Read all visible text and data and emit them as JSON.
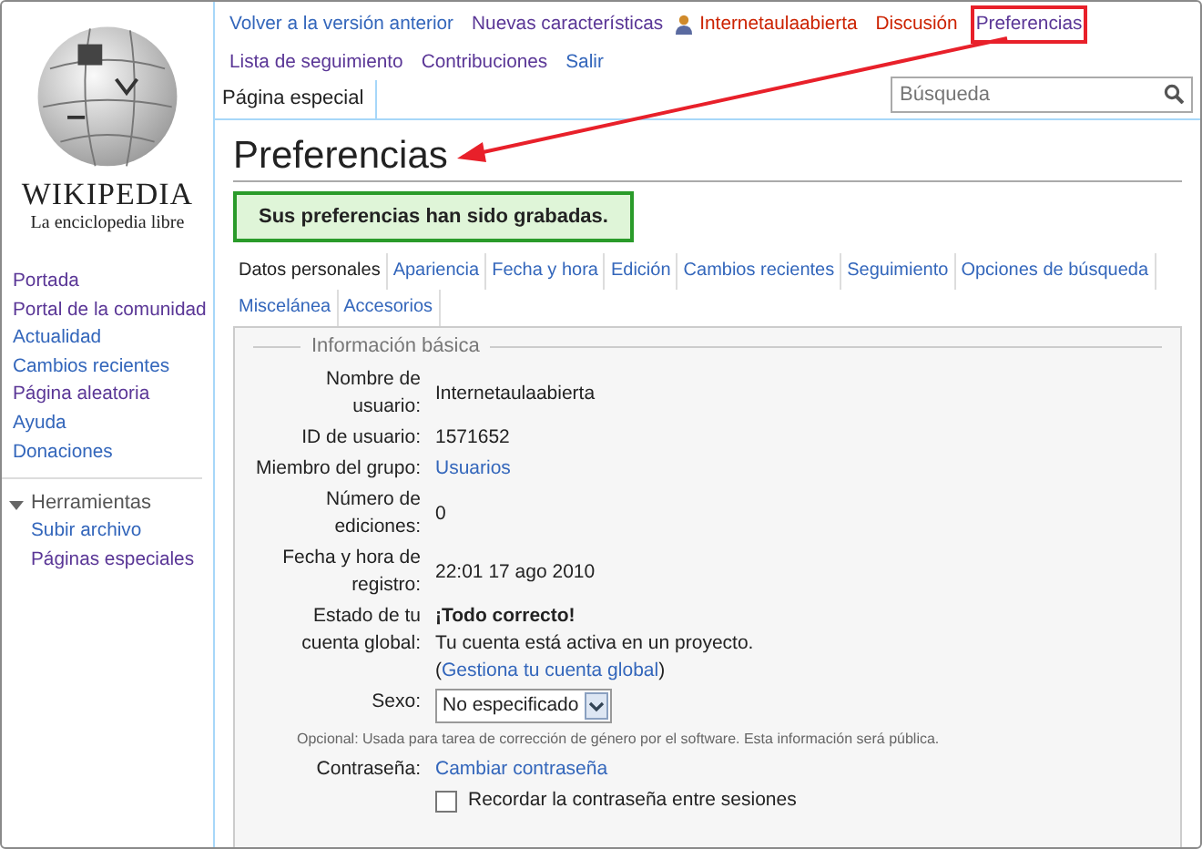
{
  "logo": {
    "wordmark": "WIKIPEDIA",
    "tagline": "La enciclopedia libre"
  },
  "top_links": [
    {
      "label": "Volver a la versión anterior",
      "color": "#3366bb",
      "kind": "link",
      "highlighted": false
    },
    {
      "label": "Nuevas características",
      "color": "#5a3696",
      "kind": "link",
      "highlighted": false
    },
    {
      "label": "Internetaulaabierta",
      "color": "#cc2200",
      "kind": "user",
      "highlighted": false
    },
    {
      "label": "Discusión",
      "color": "#cc2200",
      "kind": "link",
      "highlighted": false
    },
    {
      "label": "Preferencias",
      "color": "#5a3696",
      "kind": "link",
      "highlighted": true
    },
    {
      "label": "Lista de seguimiento",
      "color": "#5a3696",
      "kind": "link",
      "highlighted": false
    },
    {
      "label": "Contribuciones",
      "color": "#5a3696",
      "kind": "link",
      "highlighted": false
    },
    {
      "label": "Salir",
      "color": "#3366bb",
      "kind": "link",
      "highlighted": false
    }
  ],
  "page_tab": {
    "label": "Página especial",
    "selected": true
  },
  "search": {
    "placeholder": "Búsqueda"
  },
  "sidebar": {
    "items": [
      {
        "label": "Portada",
        "color": "#5a3696"
      },
      {
        "label": "Portal de la comunidad",
        "color": "#5a3696"
      },
      {
        "label": "Actualidad",
        "color": "#3366bb"
      },
      {
        "label": "Cambios recientes",
        "color": "#3366bb"
      },
      {
        "label": "Página aleatoria",
        "color": "#5a3696"
      },
      {
        "label": "Ayuda",
        "color": "#3366bb"
      },
      {
        "label": "Donaciones",
        "color": "#3366bb"
      }
    ],
    "tools": {
      "title": "Herramientas",
      "expanded": true,
      "items": [
        {
          "label": "Subir archivo",
          "color": "#3366bb"
        },
        {
          "label": "Páginas especiales",
          "color": "#5a3696"
        }
      ]
    }
  },
  "title": "Preferencias",
  "success_message": "Sus preferencias han sido grabadas.",
  "pref_tabs": [
    {
      "label": "Datos personales",
      "selected": true
    },
    {
      "label": "Apariencia",
      "selected": false
    },
    {
      "label": "Fecha y hora",
      "selected": false
    },
    {
      "label": "Edición",
      "selected": false
    },
    {
      "label": "Cambios recientes",
      "selected": false
    },
    {
      "label": "Seguimiento",
      "selected": false
    },
    {
      "label": "Opciones de búsqueda",
      "selected": false
    },
    {
      "label": "Miscelánea",
      "selected": false
    },
    {
      "label": "Accesorios",
      "selected": false
    }
  ],
  "section": {
    "legend": "Información básica",
    "rows": [
      {
        "kind": "text",
        "label": "Nombre de usuario:",
        "value": "Internetaulaabierta"
      },
      {
        "kind": "text",
        "label": "ID de usuario:",
        "value": "1571652"
      },
      {
        "kind": "link",
        "label": "Miembro del grupo:",
        "value": "Usuarios"
      },
      {
        "kind": "text",
        "label": "Número de ediciones:",
        "value": "0"
      },
      {
        "kind": "text",
        "label": "Fecha y hora de registro:",
        "value": "22:01 17 ago 2010"
      },
      {
        "kind": "status",
        "label": "Estado de tu cuenta global:",
        "value": "¡Todo correcto!",
        "detail": "Tu cuenta está activa en un proyecto.",
        "link_prefix": "(",
        "link": "Gestiona tu cuenta global",
        "link_suffix": ")"
      },
      {
        "kind": "select",
        "label": "Sexo:",
        "value": "No especificado"
      },
      {
        "kind": "note",
        "value": "Opcional: Usada para tarea de corrección de género por el software. Esta información será pública."
      },
      {
        "kind": "link",
        "label": "Contraseña:",
        "value": "Cambiar contraseña"
      },
      {
        "kind": "checkbox",
        "value": "Recordar la contraseña entre sesiones",
        "checked": false
      }
    ]
  }
}
